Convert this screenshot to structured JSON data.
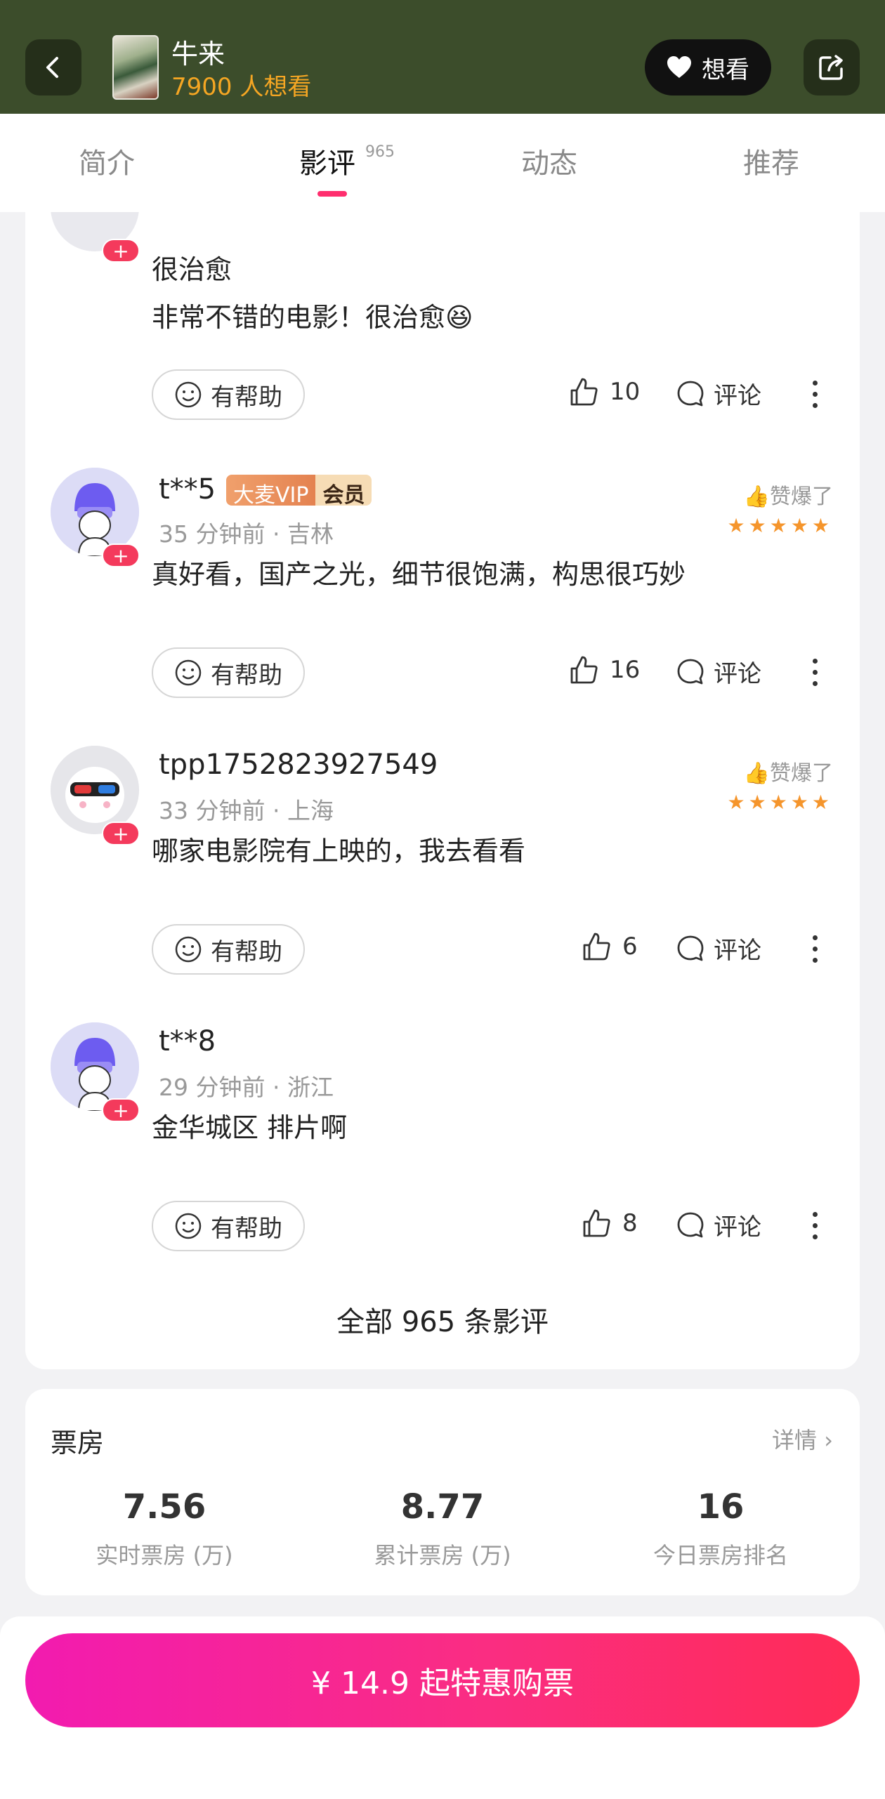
{
  "header": {
    "movie_title": "牛来",
    "want_count": "7900 人想看",
    "want_button_label": "想看",
    "back_icon": "chevron-left-icon",
    "share_icon": "share-icon",
    "heart_icon": "heart-icon"
  },
  "tabs": [
    {
      "label": "简介"
    },
    {
      "label": "影评",
      "count": "965"
    },
    {
      "label": "动态"
    },
    {
      "label": "推荐"
    }
  ],
  "colors": {
    "header_bg": "#3c4d2b",
    "accent": "#ff2e6e",
    "want_count": "#f5a623",
    "star": "#f5952c",
    "buy_gradient_start": "#f21bb0",
    "buy_gradient_end": "#ff2c56"
  },
  "reviews": [
    {
      "title": "很治愈",
      "text": "非常不错的电影！很治愈😆",
      "helpful_label": "有帮助",
      "likes": "10",
      "comment_label": "评论"
    },
    {
      "username": "t**5",
      "vip_label": "大麦VIP",
      "member_label": "会员",
      "meta": "35 分钟前 · 吉林",
      "praise": "👍赞爆了",
      "stars": "★★★★★",
      "text": "真好看，国产之光，细节很饱满，构思很巧妙",
      "helpful_label": "有帮助",
      "likes": "16",
      "comment_label": "评论"
    },
    {
      "username": "tpp1752823927549",
      "meta": "33 分钟前 · 上海",
      "praise": "👍赞爆了",
      "stars": "★★★★★",
      "text": "哪家电影院有上映的，我去看看",
      "helpful_label": "有帮助",
      "likes": "6",
      "comment_label": "评论"
    },
    {
      "username": "t**8",
      "meta": "29 分钟前 · 浙江",
      "text": "金华城区 排片啊",
      "helpful_label": "有帮助",
      "likes": "8",
      "comment_label": "评论"
    }
  ],
  "all_reviews_label": "全部 965 条影评",
  "box_office": {
    "title": "票房",
    "detail_label": "详情 ›",
    "stats": [
      {
        "value": "7.56",
        "label": "实时票房 (万)"
      },
      {
        "value": "8.77",
        "label": "累计票房 (万)"
      },
      {
        "value": "16",
        "label": "今日票房排名"
      }
    ]
  },
  "buy_button_label": "¥ 14.9 起特惠购票"
}
